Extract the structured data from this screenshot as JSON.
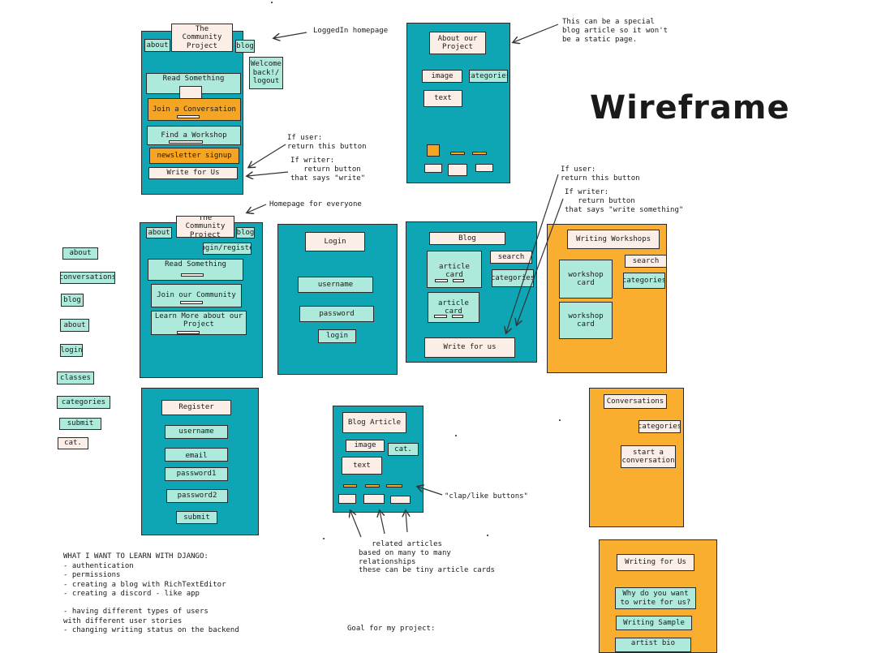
{
  "title": "Wireframe",
  "logged_in_home": {
    "title": "The Community Project",
    "about": "about",
    "blog": "blog",
    "welcome": "Welcome back!/ logout",
    "read": "Read Something",
    "join": "Join a Conversation",
    "workshop": "Find a Workshop",
    "newsletter": "newsletter signup",
    "write": "Write for Us"
  },
  "about_page": {
    "title": "About our Project",
    "image": "image",
    "categories": "categories",
    "text": "text"
  },
  "public_home": {
    "title": "The Community Project",
    "about": "about",
    "blog": "blog",
    "login_register": "login/register",
    "read": "Read Something",
    "join": "Join our Community",
    "learn": "Learn More about our Project"
  },
  "login_page": {
    "title": "Login",
    "username": "username",
    "password": "password",
    "button": "login"
  },
  "blog_page": {
    "title": "Blog",
    "article_card_1": "article card",
    "article_card_2": "article card",
    "search": "search",
    "categories": "categories",
    "write": "Write for us"
  },
  "workshops_page": {
    "title": "Writing Workshops",
    "card_1": "workshop card",
    "card_2": "workshop card",
    "search": "search",
    "categories": "categories"
  },
  "register_page": {
    "title": "Register",
    "username": "username",
    "email": "email",
    "password1": "password1",
    "password2": "password2",
    "submit": "submit"
  },
  "article_page": {
    "title": "Blog Article",
    "image": "image",
    "cat": "cat.",
    "text": "text"
  },
  "conversations_page": {
    "title": "Conversations",
    "categories": "categories",
    "start": "start a conversation"
  },
  "write_page": {
    "title": "Writing for Us",
    "why": "Why do you want to write for us?",
    "sample": "Writing Sample",
    "bio": "artist bio"
  },
  "legend": [
    "about",
    "conversations",
    "blog",
    "about",
    "login",
    "classes",
    "categories",
    "submit",
    "cat."
  ],
  "notes": {
    "logged_in": "LoggedIn homepage",
    "special": "This can be a special\nblog article so it won't\nbe a static page.",
    "if_user_1": "If user:\nreturn this button",
    "if_writer_1": "If writer:\n   return button\nthat says \"write\"",
    "if_user_2": "If user:\nreturn this button",
    "if_writer_2": "If writer:\n   return button\nthat says \"write something\"",
    "homepage_everyone": "Homepage for everyone",
    "clap": "\"clap/like buttons\"",
    "related": "   related articles\nbased on many to many\nrelationships\nthese can be tiny article cards",
    "learn_heading": "WHAT I WANT TO LEARN WITH DJANGO:",
    "learn_list": "- authentication\n- permissions\n- creating a blog with RichTextEditor\n- creating a discord - like app\n\n- having different types of users\nwith different user stories\n- changing writing status on the backend",
    "goal": "Goal for my project:"
  }
}
